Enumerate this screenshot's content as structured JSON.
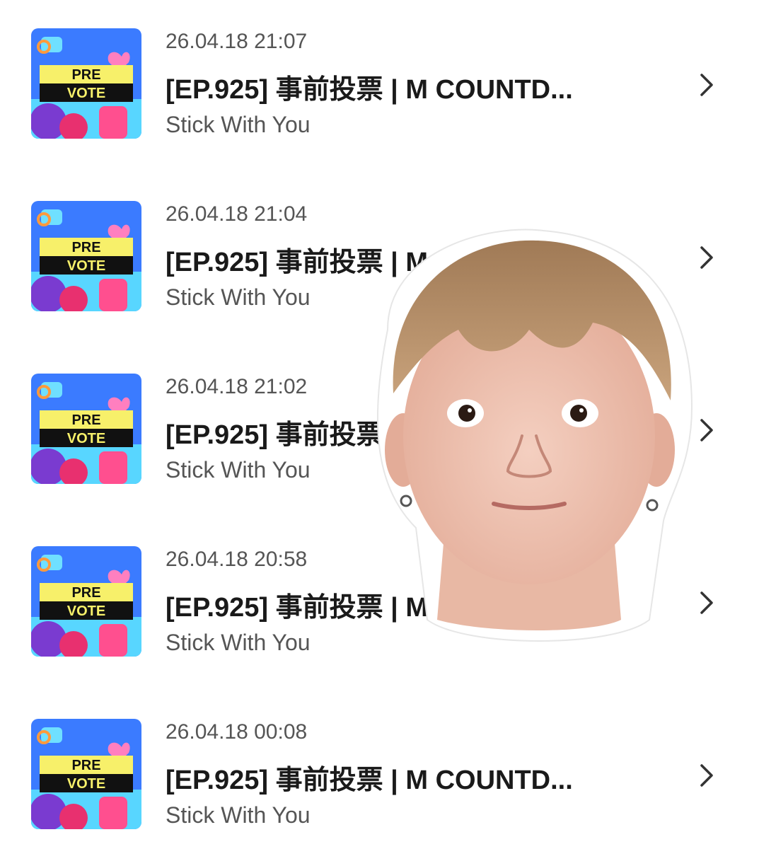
{
  "thumbnail": {
    "line1": "PRE",
    "line2": "VOTE",
    "colors": {
      "background": "#3b7bff",
      "accent_yellow": "#f7f06a",
      "banner_dark": "#111111",
      "heart_pink": "#ff7fbf",
      "cyan": "#4ee3ff",
      "magenta": "#e8306f"
    }
  },
  "items": [
    {
      "timestamp": "26.04.18 21:07",
      "title": "[EP.925] 事前投票 | M COUNTD...",
      "artist": "Stick With You"
    },
    {
      "timestamp": "26.04.18 21:04",
      "title": "[EP.925] 事前投票 | M COUNTD...",
      "artist": "Stick With You"
    },
    {
      "timestamp": "26.04.18 21:02",
      "title": "[EP.925] 事前投票 | M COUNTD...",
      "artist": "Stick With You"
    },
    {
      "timestamp": "26.04.18 20:58",
      "title": "[EP.925] 事前投票 | M COUNTD...",
      "artist": "Stick With You"
    },
    {
      "timestamp": "26.04.18 00:08",
      "title": "[EP.925] 事前投票 | M COUNTD...",
      "artist": "Stick With You"
    }
  ],
  "icons": {
    "row_arrow": "chevron-right-icon",
    "overlay": "surprised-face-sticker"
  },
  "colors": {
    "text_primary": "#1a1a1a",
    "text_secondary": "#555555",
    "background": "#ffffff"
  }
}
